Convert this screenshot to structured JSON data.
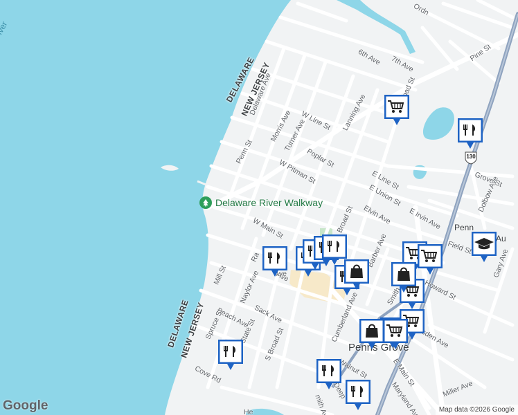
{
  "map": {
    "water_color": "#8ed6e8",
    "land_color": "#f1f3f4",
    "road_color": "#ffffff",
    "highway_color": "#8fa3bf",
    "town_label": "Penns Grove",
    "poi": {
      "label": "Delaware River Walkway",
      "icon": "tree-icon",
      "color": "#2e9e5a"
    },
    "state_labels": [
      {
        "text": "DELAWARE"
      },
      {
        "text": "NEW JERSEY"
      },
      {
        "text": "DELAWARE"
      },
      {
        "text": "NEW JERSEY"
      }
    ],
    "water_label": "iver",
    "highway_shield": "130",
    "street_labels": [
      "6th Ave",
      "7th Ave",
      "Pine St",
      "Delaware Ave",
      "W Line St",
      "Morris Ave",
      "Turner Ave",
      "Lanning Ave",
      "Poplar St",
      "Penn St",
      "W Pitman St",
      "E Line St",
      "E Union St",
      "Grove St",
      "Dolbow Ave",
      "E Irvin Ave",
      "Elvin Ave",
      "W Main St",
      "Broad St",
      "Barber Ave",
      "Field St",
      "Gary Ave",
      "Mill St",
      "Naylor Ave",
      "Ra",
      "Ave",
      "Howard St",
      "Sack Ave",
      "Beach Ave",
      "State St",
      "Spruce St",
      "S Broad St",
      "Cove Rd",
      "Cumberland Ave",
      "Walnut St",
      "Smith Ave",
      "Marsden Ave",
      "E Main St",
      "Maryland Ave",
      "Miller Ave",
      "Deep",
      "mith Ave",
      "Penn",
      "Au",
      "Ordn",
      "oad St",
      "He",
      "Aye"
    ],
    "markers": [
      {
        "type": "restaurant",
        "icon": "fork-knife-icon"
      },
      {
        "type": "restaurant",
        "icon": "fork-knife-icon"
      },
      {
        "type": "restaurant",
        "icon": "fork-knife-icon"
      },
      {
        "type": "restaurant",
        "icon": "fork-knife-icon"
      },
      {
        "type": "restaurant",
        "icon": "fork-knife-icon"
      },
      {
        "type": "restaurant",
        "icon": "fork-knife-icon"
      },
      {
        "type": "restaurant",
        "icon": "fork-knife-icon"
      },
      {
        "type": "restaurant",
        "icon": "fork-knife-icon"
      },
      {
        "type": "restaurant",
        "icon": "fork-knife-icon"
      },
      {
        "type": "restaurant",
        "icon": "fork-knife-icon"
      },
      {
        "type": "restaurant",
        "icon": "fork-knife-icon"
      },
      {
        "type": "grocery",
        "icon": "shopping-cart-icon"
      },
      {
        "type": "grocery",
        "icon": "shopping-cart-icon"
      },
      {
        "type": "grocery",
        "icon": "shopping-cart-icon"
      },
      {
        "type": "grocery",
        "icon": "shopping-cart-icon"
      },
      {
        "type": "grocery",
        "icon": "shopping-cart-icon"
      },
      {
        "type": "grocery",
        "icon": "shopping-cart-icon"
      },
      {
        "type": "shopping",
        "icon": "shopping-bag-icon"
      },
      {
        "type": "shopping",
        "icon": "shopping-bag-icon"
      },
      {
        "type": "shopping",
        "icon": "shopping-bag-icon"
      },
      {
        "type": "school",
        "icon": "graduation-cap-icon"
      }
    ]
  },
  "branding": {
    "logo": "Google",
    "attribution": "Map data ©2026 Google"
  }
}
